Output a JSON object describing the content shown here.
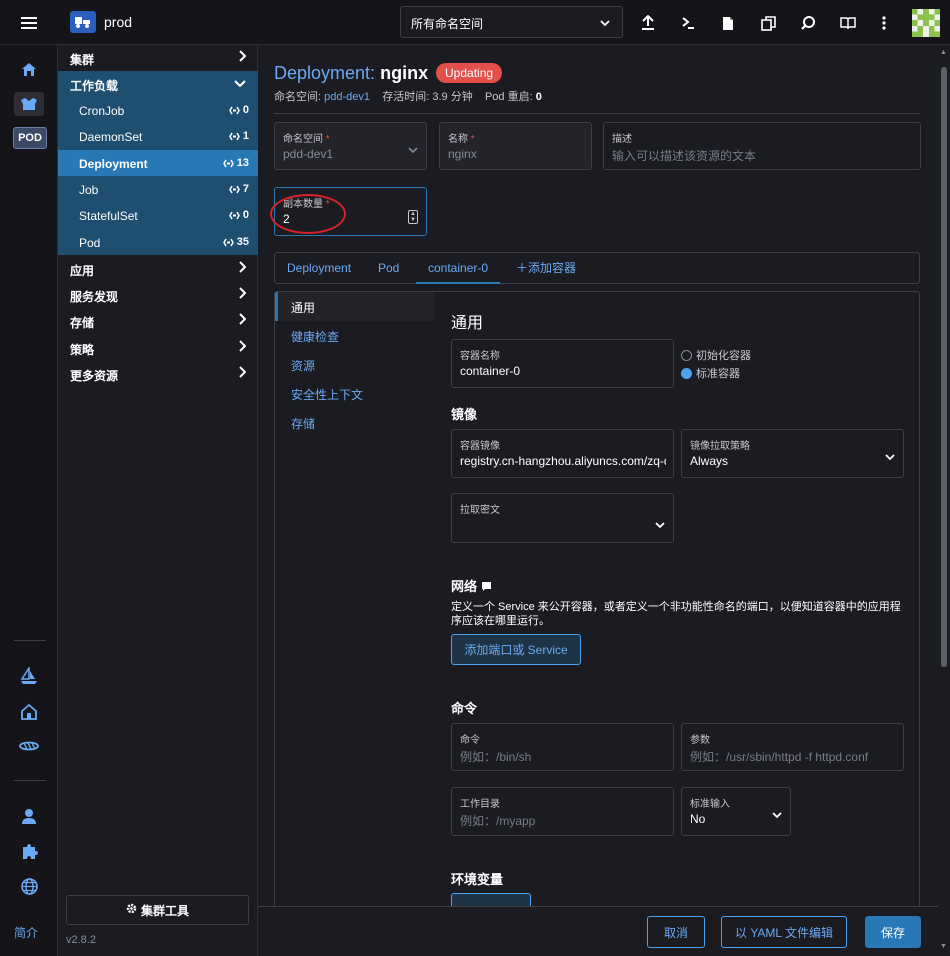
{
  "header": {
    "cluster_name": "prod",
    "namespace_select": "所有命名空间",
    "icons": [
      "upload-icon",
      "terminal-icon",
      "file-icon",
      "copy-icon",
      "search-icon",
      "book-icon",
      "more-vert-icon"
    ]
  },
  "rail": {
    "pod_label": "POD",
    "intro_label": "简介"
  },
  "nav": {
    "groups": {
      "cluster": "集群",
      "workload": "工作负载",
      "apps": "应用",
      "service_discovery": "服务发现",
      "storage": "存储",
      "policy": "策略",
      "more": "更多资源"
    },
    "workload_items": [
      {
        "label": "CronJob",
        "count": "0"
      },
      {
        "label": "DaemonSet",
        "count": "1"
      },
      {
        "label": "Deployment",
        "count": "13"
      },
      {
        "label": "Job",
        "count": "7"
      },
      {
        "label": "StatefulSet",
        "count": "0"
      },
      {
        "label": "Pod",
        "count": "35"
      }
    ],
    "cluster_tools": "集群工具",
    "version": "v2.8.2"
  },
  "page": {
    "kind": "Deployment:",
    "name": "nginx",
    "status": "Updating",
    "meta": {
      "ns_label": "命名空间:",
      "ns_value": "pdd-dev1",
      "age_label": "存活时间:",
      "age_value": "3.9 分钟",
      "restarts_label": "Pod 重启:",
      "restarts_value": "0"
    }
  },
  "form": {
    "namespace": {
      "label": "命名空间",
      "value": "pdd-dev1"
    },
    "name": {
      "label": "名称",
      "value": "nginx"
    },
    "description": {
      "label": "描述",
      "placeholder": "输入可以描述该资源的文本"
    },
    "replicas": {
      "label": "副本数量",
      "value": "2"
    }
  },
  "tabs": [
    "Deployment",
    "Pod",
    "container-0"
  ],
  "add_container": "添加容器",
  "vtabs": [
    "通用",
    "健康检查",
    "资源",
    "安全性上下文",
    "存储"
  ],
  "general": {
    "title": "通用",
    "container_name": {
      "label": "容器名称",
      "value": "container-0"
    },
    "radio_init": "初始化容器",
    "radio_standard": "标准容器",
    "image_title": "镜像",
    "image": {
      "label": "容器镜像",
      "value": "registry.cn-hangzhou.aliyuncs.com/zq-demo/nginx:latest"
    },
    "pull_policy": {
      "label": "镜像拉取策略",
      "value": "Always"
    },
    "pull_secret": {
      "label": "拉取密文"
    },
    "network_title": "网络",
    "network_desc": "定义一个 Service 来公开容器，或者定义一个非功能性命名的端口，以便知道容器中的应用程序应该在哪里运行。",
    "add_port_button": "添加端口或 Service",
    "command_title": "命令",
    "command": {
      "label": "命令",
      "placeholder": "例如：/bin/sh"
    },
    "args": {
      "label": "参数",
      "placeholder": "例如：/usr/sbin/httpd -f httpd.conf"
    },
    "workdir": {
      "label": "工作目录",
      "placeholder": "例如：/myapp"
    },
    "stdin": {
      "label": "标准输入",
      "value": "No"
    },
    "env_title": "环境变量"
  },
  "footer": {
    "cancel": "取消",
    "edit_yaml": "以 YAML 文件编辑",
    "save": "保存"
  },
  "colors": {
    "accent": "#2878b6",
    "link": "#6aa9f4",
    "status_red": "#e3504b",
    "annotation": "#d8232a"
  }
}
